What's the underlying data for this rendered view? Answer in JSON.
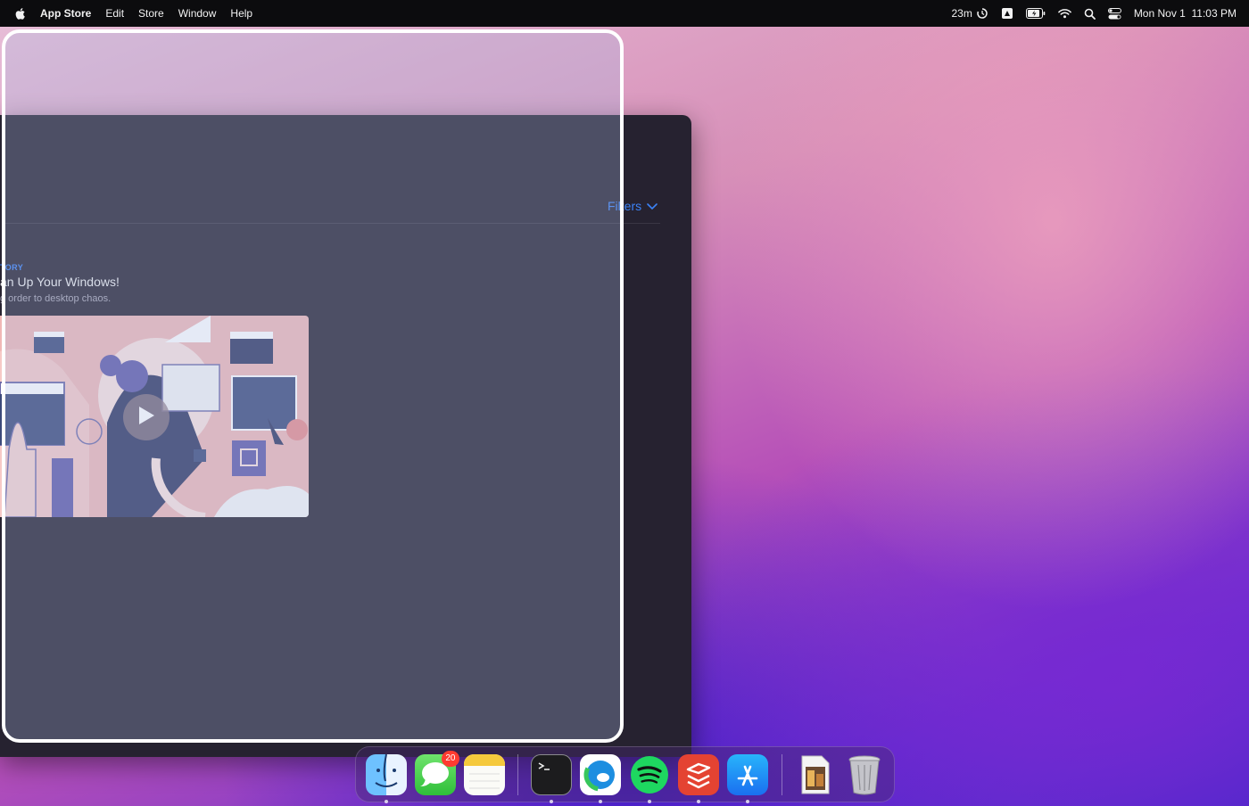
{
  "menubar": {
    "app_name": "App Store",
    "menus": [
      "Edit",
      "Store",
      "Window",
      "Help"
    ],
    "timer_label": "23m",
    "date": "Mon Nov 1",
    "time": "11:03 PM"
  },
  "app_window": {
    "filters_label": "Filters",
    "story": {
      "eyebrow": "TORY",
      "title": "an Up Your Windows!",
      "subtitle": "g order to desktop chaos."
    }
  },
  "dock": {
    "items": [
      {
        "name": "Finder",
        "icon": "finder-icon",
        "running": true
      },
      {
        "name": "Messages",
        "icon": "messages-icon",
        "badge": "20",
        "running": false
      },
      {
        "name": "Notes",
        "icon": "notes-icon",
        "running": false
      },
      {
        "name": "Terminal",
        "icon": "terminal-icon",
        "running": true
      },
      {
        "name": "Microsoft Edge",
        "icon": "edge-icon",
        "running": true
      },
      {
        "name": "Spotify",
        "icon": "spotify-icon",
        "running": true
      },
      {
        "name": "Todoist",
        "icon": "todoist-icon",
        "running": true
      },
      {
        "name": "App Store",
        "icon": "app-store-icon",
        "running": true
      },
      {
        "name": "Document",
        "icon": "document-icon",
        "running": false
      },
      {
        "name": "Trash",
        "icon": "trash-icon",
        "running": false
      }
    ]
  },
  "colors": {
    "accent": "#3b82f6",
    "menubar_bg": "#0c0c0e",
    "window_bg": "#262230",
    "badge": "#ff3b30"
  }
}
